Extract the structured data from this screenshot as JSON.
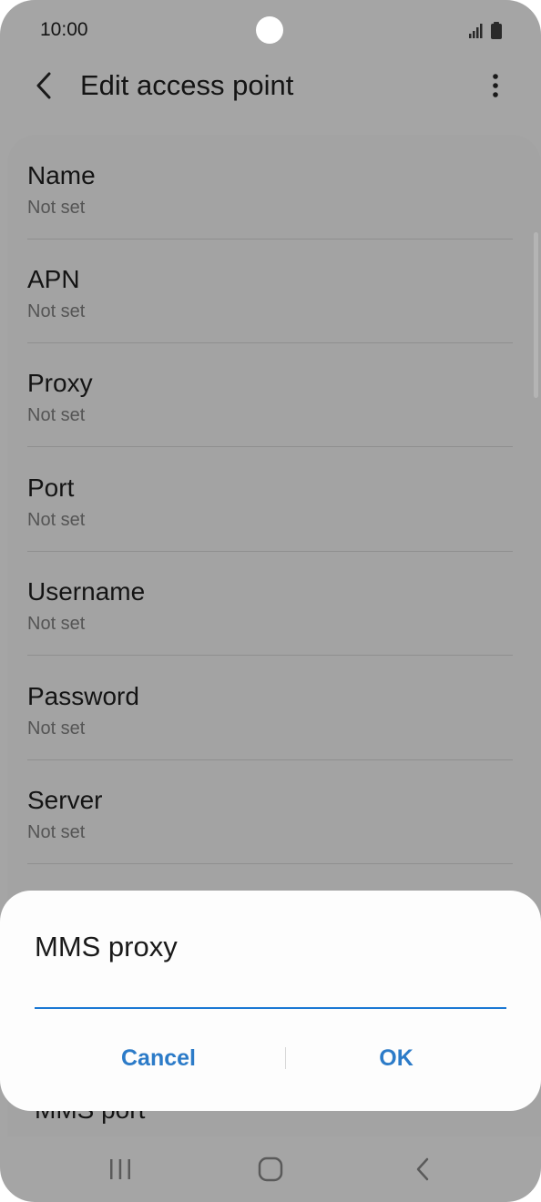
{
  "status_bar": {
    "time": "10:00",
    "icons": [
      "signal-icon",
      "battery-icon"
    ]
  },
  "app_bar": {
    "title": "Edit access point",
    "icons": [
      "back-arrow-icon",
      "more-options-icon"
    ]
  },
  "settings": {
    "items": [
      {
        "label": "Name",
        "value": "Not set"
      },
      {
        "label": "APN",
        "value": "Not set"
      },
      {
        "label": "Proxy",
        "value": "Not set"
      },
      {
        "label": "Port",
        "value": "Not set"
      },
      {
        "label": "Username",
        "value": "Not set"
      },
      {
        "label": "Password",
        "value": "Not set"
      },
      {
        "label": "Server",
        "value": "Not set"
      }
    ],
    "partial_item": "MMS port"
  },
  "dialog": {
    "title": "MMS proxy",
    "input_value": "",
    "cancel_label": "Cancel",
    "ok_label": "OK"
  },
  "nav_bar": {
    "icons": [
      "recent-apps-icon",
      "home-icon",
      "back-icon"
    ]
  },
  "colors": {
    "accent": "#2c7bc8",
    "input_underline": "#1b78d4",
    "scrim": "#a5a5a5",
    "dialog_bg": "#fdfdfd"
  }
}
